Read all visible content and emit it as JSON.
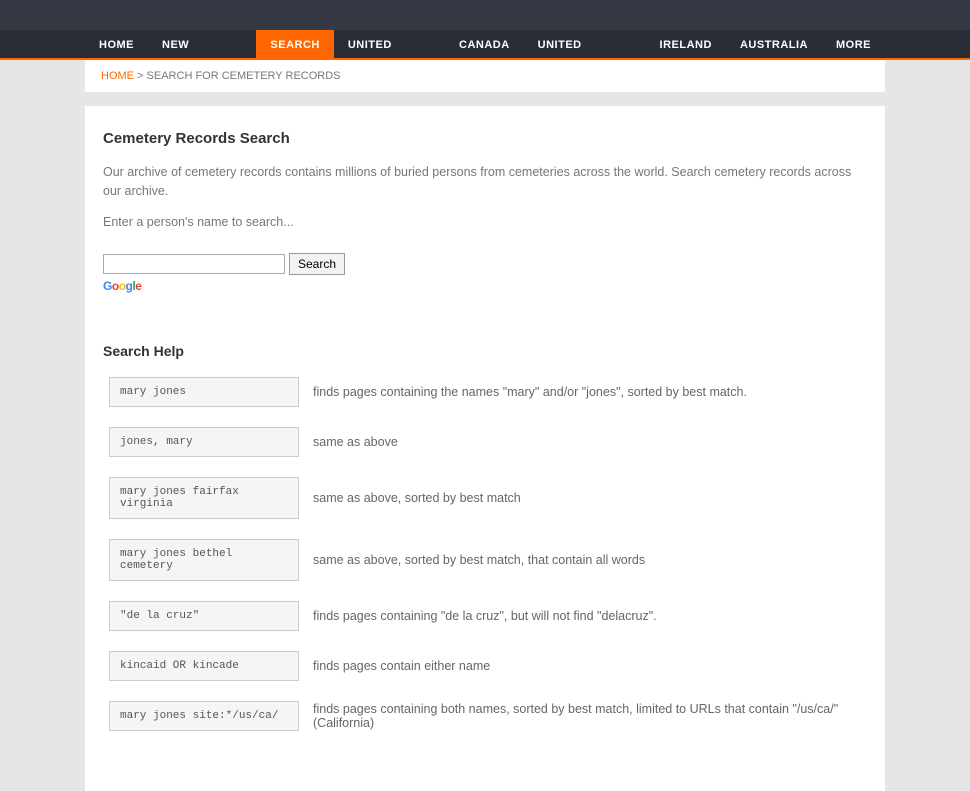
{
  "nav": {
    "items": [
      {
        "label": "HOME"
      },
      {
        "label": "NEW RECORDS"
      },
      {
        "label": "SEARCH",
        "active": true
      },
      {
        "label": "UNITED STATES"
      },
      {
        "label": "CANADA"
      },
      {
        "label": "UNITED KINGDOM"
      },
      {
        "label": "IRELAND"
      },
      {
        "label": "AUSTRALIA"
      },
      {
        "label": "MORE"
      }
    ]
  },
  "breadcrumb": {
    "home": "HOME",
    "sep": " > ",
    "current": "SEARCH FOR CEMETERY RECORDS"
  },
  "page": {
    "title": "Cemetery Records Search",
    "desc": "Our archive of cemetery records contains millions of buried persons from cemeteries across the world. Search cemetery records across our archive.",
    "hint": "Enter a person's name to search...",
    "search_button": "Search",
    "help_title": "Search Help"
  },
  "help": [
    {
      "example": "mary jones",
      "desc": "finds pages containing the names \"mary\" and/or \"jones\", sorted by best match."
    },
    {
      "example": "jones, mary",
      "desc": "same as above"
    },
    {
      "example": "mary jones fairfax virginia",
      "desc": "same as above, sorted by best match"
    },
    {
      "example": "mary jones bethel cemetery",
      "desc": "same as above, sorted by best match, that contain all words"
    },
    {
      "example": "\"de la cruz\"",
      "desc": "finds pages containing \"de la cruz\", but will not find \"delacruz\"."
    },
    {
      "example": "kincaid OR kincade",
      "desc": "finds pages contain either name"
    },
    {
      "example": "mary jones site:*/us/ca/",
      "desc": "finds pages containing both names, sorted by best match, limited to URLs that contain \"/us/ca/\" (California)"
    }
  ]
}
